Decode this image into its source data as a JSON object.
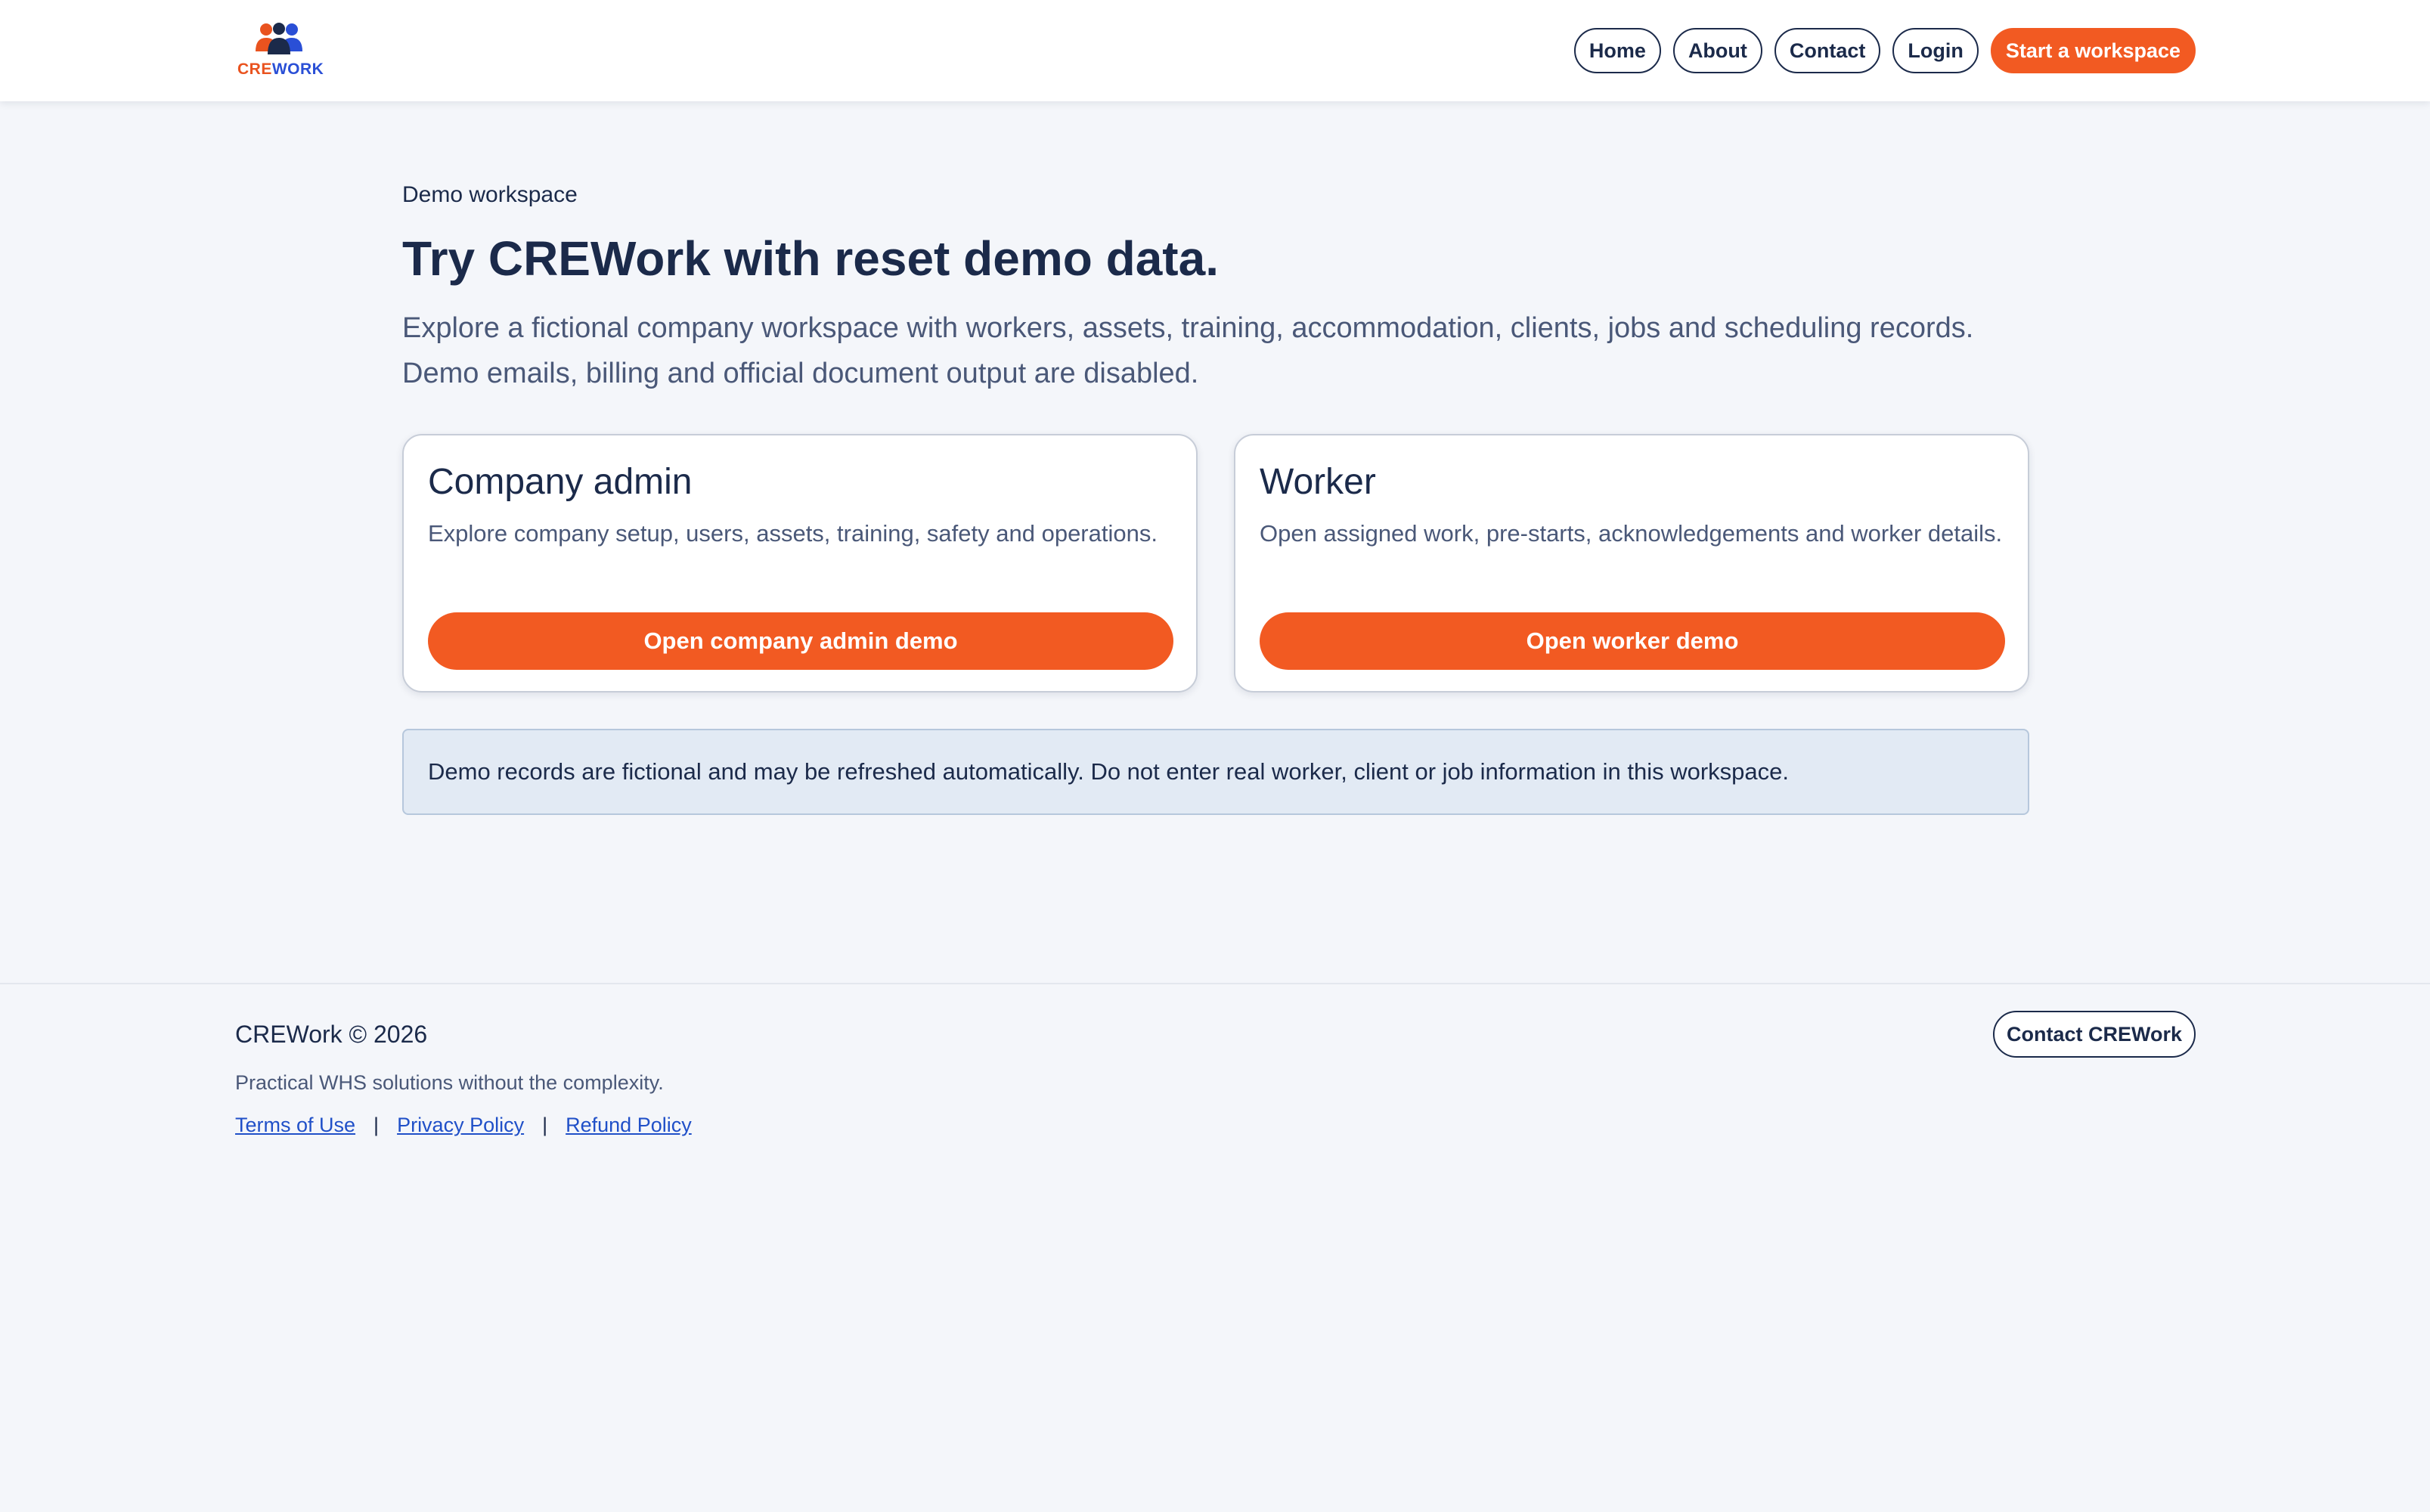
{
  "brand": {
    "logo_prefix": "CRE",
    "logo_suffix": "WORK",
    "colors": {
      "orange": "#f25a22",
      "blue": "#2a4fd6",
      "navy": "#1b2a4a"
    }
  },
  "nav": {
    "items": [
      "Home",
      "About",
      "Contact",
      "Login"
    ],
    "cta": "Start a workspace"
  },
  "hero": {
    "eyebrow": "Demo workspace",
    "title": "Try CREWork with reset demo data.",
    "lead": "Explore a fictional company workspace with workers, assets, training, accommodation, clients, jobs and scheduling records. Demo emails, billing and official document output are disabled."
  },
  "cards": [
    {
      "title": "Company admin",
      "description": "Explore company setup, users, assets, training, safety and operations.",
      "button": "Open company admin demo"
    },
    {
      "title": "Worker",
      "description": "Open assigned work, pre-starts, acknowledgements and worker details.",
      "button": "Open worker demo"
    }
  ],
  "notice": "Demo records are fictional and may be refreshed automatically. Do not enter real worker, client or job information in this workspace.",
  "footer": {
    "copyright": "CREWork © 2026",
    "tagline": "Practical WHS solutions without the complexity.",
    "links": [
      "Terms of Use",
      "Privacy Policy",
      "Refund Policy"
    ],
    "separator": "|",
    "contact_button": "Contact CREWork"
  }
}
